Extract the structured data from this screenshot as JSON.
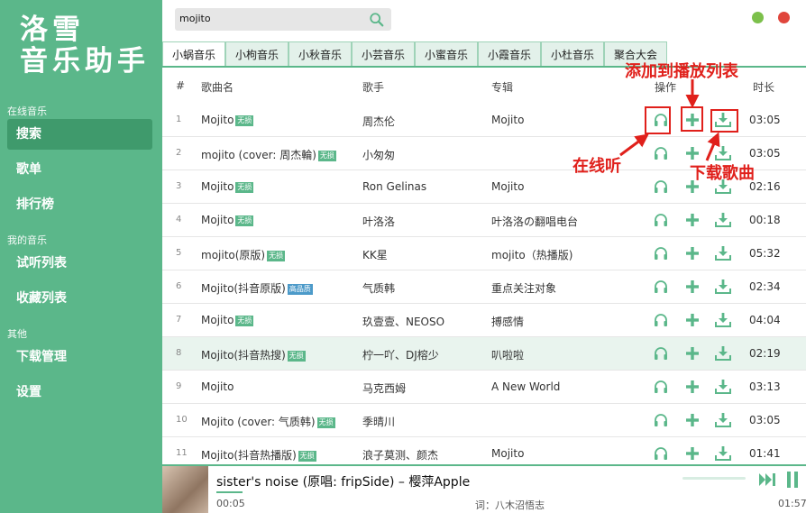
{
  "app": {
    "title_line1": "洛雪",
    "title_line2": "音乐助手"
  },
  "sidebar": {
    "section_online": "在线音乐",
    "search": "搜索",
    "songlist": "歌单",
    "rank": "排行榜",
    "section_mine": "我的音乐",
    "trial": "试听列表",
    "fav": "收藏列表",
    "section_other": "其他",
    "download": "下载管理",
    "settings": "设置"
  },
  "search": {
    "value": "mojito"
  },
  "window": {
    "min_color": "#7cc04b",
    "close_color": "#e0463c"
  },
  "tabs": [
    "小蜗音乐",
    "小枸音乐",
    "小秋音乐",
    "小芸音乐",
    "小蜜音乐",
    "小霞音乐",
    "小杜音乐",
    "聚合大会"
  ],
  "table": {
    "headers": {
      "idx": "#",
      "name": "歌曲名",
      "singer": "歌手",
      "album": "专辑",
      "ops": "操作",
      "duration": "时长"
    },
    "rows": [
      {
        "idx": "1",
        "name": "Mojito",
        "badge": "无损",
        "badge_type": "lossless",
        "singer": "周杰伦",
        "album": "Mojito",
        "time": "03:05"
      },
      {
        "idx": "2",
        "name": "mojito (cover: 周杰輪)",
        "badge": "无损",
        "badge_type": "lossless",
        "singer": "小匆匆",
        "album": "",
        "time": "03:05"
      },
      {
        "idx": "3",
        "name": "Mojito",
        "badge": "无损",
        "badge_type": "lossless",
        "singer": "Ron Gelinas",
        "album": "Mojito",
        "time": "02:16"
      },
      {
        "idx": "4",
        "name": "Mojito",
        "badge": "无损",
        "badge_type": "lossless",
        "singer": "叶洛洛",
        "album": "叶洛洛の翻唱电台",
        "time": "00:18"
      },
      {
        "idx": "5",
        "name": "mojito(原版)",
        "badge": "无损",
        "badge_type": "lossless",
        "singer": "KK星",
        "album": "mojito（热播版)",
        "time": "05:32"
      },
      {
        "idx": "6",
        "name": "Mojito(抖音原版)",
        "badge": "高品质",
        "badge_type": "hq",
        "singer": "气质韩",
        "album": "重点关注对象",
        "time": "02:34"
      },
      {
        "idx": "7",
        "name": "Mojito",
        "badge": "无损",
        "badge_type": "lossless",
        "singer": "玖壹壹、NEOSO",
        "album": "搏感情",
        "time": "04:04"
      },
      {
        "idx": "8",
        "name": "Mojito(抖音热搜)",
        "badge": "无损",
        "badge_type": "lossless",
        "singer": "柠一吖、DJ榕少",
        "album": "叭啦啦",
        "time": "02:19"
      },
      {
        "idx": "9",
        "name": "Mojito",
        "badge": "",
        "badge_type": "",
        "singer": "马克西姆",
        "album": "A New World",
        "time": "03:13"
      },
      {
        "idx": "10",
        "name": "Mojito (cover: 气质韩)",
        "badge": "无损",
        "badge_type": "lossless",
        "singer": "季晴川",
        "album": "",
        "time": "03:05"
      },
      {
        "idx": "11",
        "name": "Mojito(抖音热播版)",
        "badge": "无损",
        "badge_type": "lossless",
        "singer": "浪子莫测、颜杰",
        "album": "Mojito",
        "time": "01:41"
      }
    ]
  },
  "annotations": {
    "add": "添加到播放列表",
    "listen": "在线听",
    "download": "下载歌曲"
  },
  "player": {
    "title": "sister's noise (原唱: fripSide) – 樱萍Apple",
    "elapsed": "00:05",
    "lyric": "词：八木沼悟志",
    "total": "01:57",
    "progress_fraction": 0.04
  },
  "colors": {
    "accent": "#5bb78a",
    "annotation": "#e0201b"
  }
}
